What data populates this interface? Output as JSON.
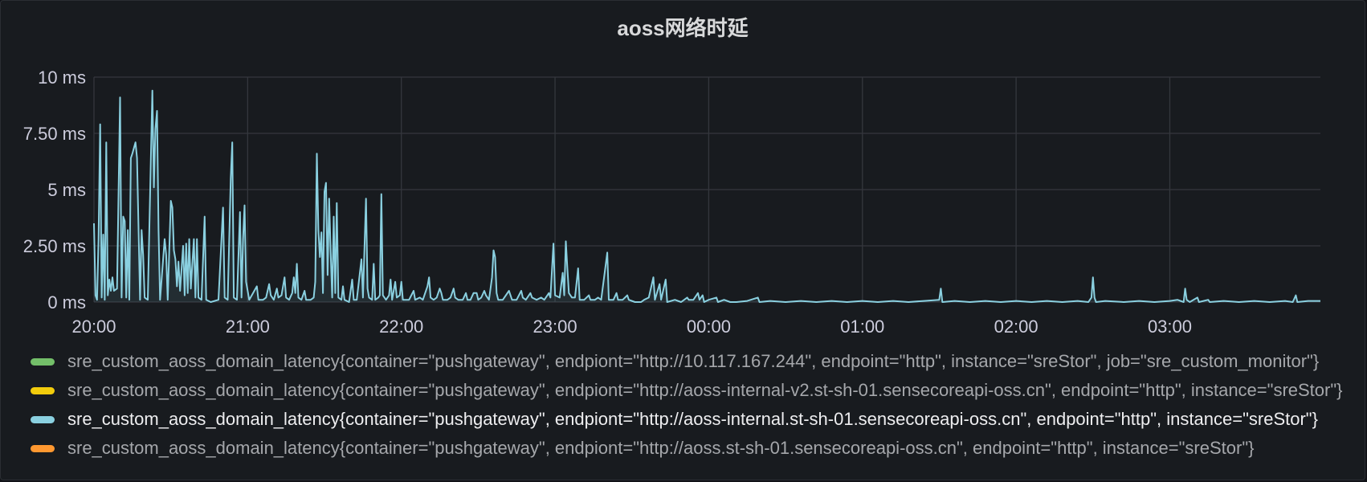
{
  "panel": {
    "title": "aoss网络时延"
  },
  "chart_data": {
    "type": "line",
    "title": "aoss网络时延",
    "y_unit": "ms",
    "ylim": [
      0,
      10
    ],
    "yticks": [
      {
        "v": 0,
        "label": "0 ms"
      },
      {
        "v": 2.5,
        "label": "2.50 ms"
      },
      {
        "v": 5,
        "label": "5 ms"
      },
      {
        "v": 7.5,
        "label": "7.50 ms"
      },
      {
        "v": 10,
        "label": "10 ms"
      }
    ],
    "xlim_hours": [
      20.0,
      27.98
    ],
    "xticks": [
      {
        "v": 20,
        "label": "20:00"
      },
      {
        "v": 21,
        "label": "21:00"
      },
      {
        "v": 22,
        "label": "22:00"
      },
      {
        "v": 23,
        "label": "23:00"
      },
      {
        "v": 24,
        "label": "00:00"
      },
      {
        "v": 25,
        "label": "01:00"
      },
      {
        "v": 26,
        "label": "02:00"
      },
      {
        "v": 27,
        "label": "03:00"
      }
    ],
    "grid": true,
    "legend_position": "bottom",
    "series": [
      {
        "name": "sre_custom_aoss_domain_latency{container=\"pushgateway\", endpiont=\"http://10.117.167.244\", endpoint=\"http\", instance=\"sreStor\", job=\"sre_custom_monitor\"}",
        "color": "#73bf69",
        "visible": false,
        "points": []
      },
      {
        "name": "sre_custom_aoss_domain_latency{container=\"pushgateway\", endpiont=\"http://aoss-internal-v2.st-sh-01.sensecoreapi-oss.cn\", endpoint=\"http\", instance=\"sreStor\"}",
        "color": "#f2cc0c",
        "visible": false,
        "points": []
      },
      {
        "name": "sre_custom_aoss_domain_latency{container=\"pushgateway\", endpiont=\"http://aoss-internal.st-sh-01.sensecoreapi-oss.cn\", endpoint=\"http\", instance=\"sreStor\"}",
        "color": "#8ad0e0",
        "visible": true,
        "points": [
          [
            20.0,
            3.5
          ],
          [
            20.01,
            0.3
          ],
          [
            20.02,
            0.1
          ],
          [
            20.03,
            2.8
          ],
          [
            20.04,
            7.9
          ],
          [
            20.05,
            0.2
          ],
          [
            20.06,
            3.0
          ],
          [
            20.07,
            0.1
          ],
          [
            20.08,
            7.1
          ],
          [
            20.09,
            0.3
          ],
          [
            20.1,
            1.0
          ],
          [
            20.11,
            0.5
          ],
          [
            20.12,
            1.1
          ],
          [
            20.13,
            0.5
          ],
          [
            20.15,
            0.6
          ],
          [
            20.17,
            9.1
          ],
          [
            20.18,
            0.2
          ],
          [
            20.19,
            3.8
          ],
          [
            20.2,
            3.6
          ],
          [
            20.21,
            0.2
          ],
          [
            20.22,
            3.2
          ],
          [
            20.23,
            0.1
          ],
          [
            20.24,
            6.4
          ],
          [
            20.25,
            6.6
          ],
          [
            20.27,
            7.1
          ],
          [
            20.28,
            6.4
          ],
          [
            20.3,
            0.1
          ],
          [
            20.31,
            3.2
          ],
          [
            20.32,
            2.1
          ],
          [
            20.33,
            0.2
          ],
          [
            20.35,
            0.1
          ],
          [
            20.38,
            9.4
          ],
          [
            20.39,
            5.1
          ],
          [
            20.4,
            7.7
          ],
          [
            20.41,
            8.5
          ],
          [
            20.42,
            3.2
          ],
          [
            20.43,
            0.1
          ],
          [
            20.46,
            2.8
          ],
          [
            20.47,
            2.1
          ],
          [
            20.48,
            0.1
          ],
          [
            20.5,
            4.5
          ],
          [
            20.51,
            4.2
          ],
          [
            20.52,
            2.3
          ],
          [
            20.53,
            1.9
          ],
          [
            20.54,
            0.7
          ],
          [
            20.55,
            1.8
          ],
          [
            20.56,
            0.5
          ],
          [
            20.58,
            2.5
          ],
          [
            20.59,
            0.3
          ],
          [
            20.6,
            2.6
          ],
          [
            20.61,
            0.4
          ],
          [
            20.62,
            2.8
          ],
          [
            20.63,
            0.6
          ],
          [
            20.65,
            2.8
          ],
          [
            20.66,
            0.2
          ],
          [
            20.67,
            2.8
          ],
          [
            20.68,
            0.2
          ],
          [
            20.7,
            0.1
          ],
          [
            20.72,
            3.8
          ],
          [
            20.73,
            0.1
          ],
          [
            20.76,
            0.0
          ],
          [
            20.81,
            0.1
          ],
          [
            20.84,
            4.2
          ],
          [
            20.85,
            0.2
          ],
          [
            20.87,
            0.1
          ],
          [
            20.89,
            5.5
          ],
          [
            20.9,
            7.1
          ],
          [
            20.91,
            0.2
          ],
          [
            20.93,
            0.1
          ],
          [
            20.95,
            4.0
          ],
          [
            20.96,
            0.2
          ],
          [
            20.97,
            2.8
          ],
          [
            20.98,
            4.3
          ],
          [
            20.99,
            0.9
          ],
          [
            21.01,
            0.1
          ],
          [
            21.06,
            0.7
          ],
          [
            21.07,
            0.1
          ],
          [
            21.1,
            0.1
          ],
          [
            21.12,
            0.2
          ],
          [
            21.14,
            0.8
          ],
          [
            21.15,
            0.3
          ],
          [
            21.17,
            0.1
          ],
          [
            21.19,
            0.6
          ],
          [
            21.2,
            0.2
          ],
          [
            21.22,
            0.3
          ],
          [
            21.24,
            1.1
          ],
          [
            21.25,
            0.2
          ],
          [
            21.27,
            0.1
          ],
          [
            21.29,
            0.4
          ],
          [
            21.3,
            1.1
          ],
          [
            21.31,
            0.4
          ],
          [
            21.32,
            1.7
          ],
          [
            21.33,
            0.2
          ],
          [
            21.35,
            0.1
          ],
          [
            21.37,
            0.5
          ],
          [
            21.38,
            0.1
          ],
          [
            21.41,
            0.1
          ],
          [
            21.43,
            0.2
          ],
          [
            21.44,
            0.9
          ],
          [
            21.45,
            6.6
          ],
          [
            21.46,
            3.2
          ],
          [
            21.47,
            2.0
          ],
          [
            21.48,
            3.1
          ],
          [
            21.49,
            0.4
          ],
          [
            21.5,
            4.9
          ],
          [
            21.51,
            5.3
          ],
          [
            21.52,
            1.2
          ],
          [
            21.53,
            4.6
          ],
          [
            21.54,
            2.2
          ],
          [
            21.55,
            0.2
          ],
          [
            21.56,
            3.8
          ],
          [
            21.57,
            0.4
          ],
          [
            21.58,
            4.4
          ],
          [
            21.59,
            0.2
          ],
          [
            21.61,
            0.1
          ],
          [
            21.62,
            0.7
          ],
          [
            21.63,
            0.1
          ],
          [
            21.66,
            0.0
          ],
          [
            21.68,
            1.0
          ],
          [
            21.69,
            0.1
          ],
          [
            21.71,
            0.1
          ],
          [
            21.74,
            1.9
          ],
          [
            21.75,
            0.2
          ],
          [
            21.77,
            4.6
          ],
          [
            21.78,
            0.6
          ],
          [
            21.79,
            0.2
          ],
          [
            21.81,
            0.1
          ],
          [
            21.82,
            1.7
          ],
          [
            21.83,
            0.1
          ],
          [
            21.85,
            0.2
          ],
          [
            21.86,
            0.3
          ],
          [
            21.87,
            4.8
          ],
          [
            21.88,
            0.3
          ],
          [
            21.9,
            0.1
          ],
          [
            21.92,
            0.3
          ],
          [
            21.93,
            1.0
          ],
          [
            21.94,
            0.1
          ],
          [
            21.96,
            0.9
          ],
          [
            21.97,
            0.2
          ],
          [
            21.99,
            0.3
          ],
          [
            22.0,
            0.9
          ],
          [
            22.01,
            0.1
          ],
          [
            22.05,
            0.1
          ],
          [
            22.08,
            0.5
          ],
          [
            22.09,
            0.1
          ],
          [
            22.12,
            0.2
          ],
          [
            22.14,
            0.1
          ],
          [
            22.17,
            0.7
          ],
          [
            22.18,
            1.1
          ],
          [
            22.19,
            0.2
          ],
          [
            22.21,
            0.1
          ],
          [
            22.23,
            0.2
          ],
          [
            22.25,
            0.6
          ],
          [
            22.26,
            0.4
          ],
          [
            22.27,
            0.1
          ],
          [
            22.3,
            0.1
          ],
          [
            22.32,
            0.2
          ],
          [
            22.34,
            0.6
          ],
          [
            22.35,
            0.2
          ],
          [
            22.37,
            0.1
          ],
          [
            22.4,
            0.1
          ],
          [
            22.42,
            0.4
          ],
          [
            22.43,
            0.1
          ],
          [
            22.45,
            0.1
          ],
          [
            22.47,
            0.4
          ],
          [
            22.49,
            0.4
          ],
          [
            22.5,
            0.1
          ],
          [
            22.52,
            0.2
          ],
          [
            22.54,
            0.5
          ],
          [
            22.55,
            0.3
          ],
          [
            22.57,
            0.1
          ],
          [
            22.59,
            1.1
          ],
          [
            22.6,
            2.3
          ],
          [
            22.61,
            2.0
          ],
          [
            22.62,
            0.4
          ],
          [
            22.63,
            0.1
          ],
          [
            22.66,
            0.1
          ],
          [
            22.7,
            0.5
          ],
          [
            22.72,
            0.1
          ],
          [
            22.75,
            0.1
          ],
          [
            22.78,
            0.5
          ],
          [
            22.79,
            0.2
          ],
          [
            22.81,
            0.1
          ],
          [
            22.84,
            0.4
          ],
          [
            22.85,
            0.2
          ],
          [
            22.88,
            0.1
          ],
          [
            22.91,
            0.2
          ],
          [
            22.93,
            0.1
          ],
          [
            22.96,
            0.4
          ],
          [
            22.97,
            0.2
          ],
          [
            22.99,
            2.6
          ],
          [
            23.0,
            0.3
          ],
          [
            23.03,
            0.2
          ],
          [
            23.05,
            1.3
          ],
          [
            23.06,
            0.3
          ],
          [
            23.07,
            2.7
          ],
          [
            23.08,
            1.5
          ],
          [
            23.09,
            0.4
          ],
          [
            23.11,
            0.2
          ],
          [
            23.13,
            0.2
          ],
          [
            23.15,
            1.5
          ],
          [
            23.16,
            0.1
          ],
          [
            23.19,
            0.1
          ],
          [
            23.22,
            0.3
          ],
          [
            23.23,
            0.1
          ],
          [
            23.26,
            0.1
          ],
          [
            23.28,
            0.2
          ],
          [
            23.3,
            0.1
          ],
          [
            23.34,
            2.2
          ],
          [
            23.35,
            0.1
          ],
          [
            23.38,
            0.1
          ],
          [
            23.4,
            0.4
          ],
          [
            23.41,
            0.1
          ],
          [
            23.44,
            0.1
          ],
          [
            23.47,
            0.3
          ],
          [
            23.48,
            0.1
          ],
          [
            23.52,
            0.0
          ],
          [
            23.56,
            0.0
          ],
          [
            23.58,
            0.1
          ],
          [
            23.61,
            0.2
          ],
          [
            23.64,
            1.1
          ],
          [
            23.65,
            0.1
          ],
          [
            23.68,
            0.8
          ],
          [
            23.69,
            0.1
          ],
          [
            23.72,
            1.0
          ],
          [
            23.73,
            0.0
          ],
          [
            23.78,
            0.1
          ],
          [
            23.82,
            0.0
          ],
          [
            23.86,
            0.2
          ],
          [
            23.87,
            0.1
          ],
          [
            23.9,
            0.1
          ],
          [
            23.93,
            0.4
          ],
          [
            23.94,
            0.1
          ],
          [
            23.96,
            0.3
          ],
          [
            23.97,
            0.0
          ],
          [
            24.0,
            0.1
          ],
          [
            24.05,
            0.2
          ],
          [
            24.06,
            0.0
          ],
          [
            24.1,
            0.1
          ],
          [
            24.14,
            0.0
          ],
          [
            24.18,
            0.0
          ],
          [
            24.25,
            0.05
          ],
          [
            24.32,
            0.2
          ],
          [
            24.33,
            0.0
          ],
          [
            24.4,
            0.05
          ],
          [
            24.5,
            0.0
          ],
          [
            24.6,
            0.05
          ],
          [
            24.7,
            0.0
          ],
          [
            24.8,
            0.05
          ],
          [
            24.9,
            0.0
          ],
          [
            25.0,
            0.05
          ],
          [
            25.1,
            0.0
          ],
          [
            25.2,
            0.05
          ],
          [
            25.3,
            0.0
          ],
          [
            25.4,
            0.05
          ],
          [
            25.5,
            0.1
          ],
          [
            25.51,
            0.6
          ],
          [
            25.52,
            0.0
          ],
          [
            25.6,
            0.05
          ],
          [
            25.7,
            0.0
          ],
          [
            25.8,
            0.05
          ],
          [
            25.9,
            0.0
          ],
          [
            26.0,
            0.05
          ],
          [
            26.1,
            0.0
          ],
          [
            26.2,
            0.05
          ],
          [
            26.3,
            0.0
          ],
          [
            26.4,
            0.05
          ],
          [
            26.47,
            0.0
          ],
          [
            26.49,
            0.2
          ],
          [
            26.5,
            1.1
          ],
          [
            26.51,
            0.2
          ],
          [
            26.52,
            0.0
          ],
          [
            26.58,
            0.05
          ],
          [
            26.7,
            0.0
          ],
          [
            26.8,
            0.05
          ],
          [
            26.9,
            0.0
          ],
          [
            27.0,
            0.05
          ],
          [
            27.05,
            0.1
          ],
          [
            27.09,
            0.0
          ],
          [
            27.1,
            0.6
          ],
          [
            27.11,
            0.1
          ],
          [
            27.13,
            0.0
          ],
          [
            27.18,
            0.2
          ],
          [
            27.19,
            0.0
          ],
          [
            27.25,
            0.1
          ],
          [
            27.26,
            0.0
          ],
          [
            27.35,
            0.05
          ],
          [
            27.45,
            0.0
          ],
          [
            27.55,
            0.05
          ],
          [
            27.65,
            0.0
          ],
          [
            27.75,
            0.05
          ],
          [
            27.8,
            0.0
          ],
          [
            27.82,
            0.3
          ],
          [
            27.83,
            0.0
          ],
          [
            27.9,
            0.05
          ],
          [
            27.98,
            0.05
          ]
        ]
      },
      {
        "name": "sre_custom_aoss_domain_latency{container=\"pushgateway\", endpiont=\"http://aoss.st-sh-01.sensecoreapi-oss.cn\", endpoint=\"http\", instance=\"sreStor\"}",
        "color": "#ff9830",
        "visible": false,
        "points": []
      }
    ]
  }
}
